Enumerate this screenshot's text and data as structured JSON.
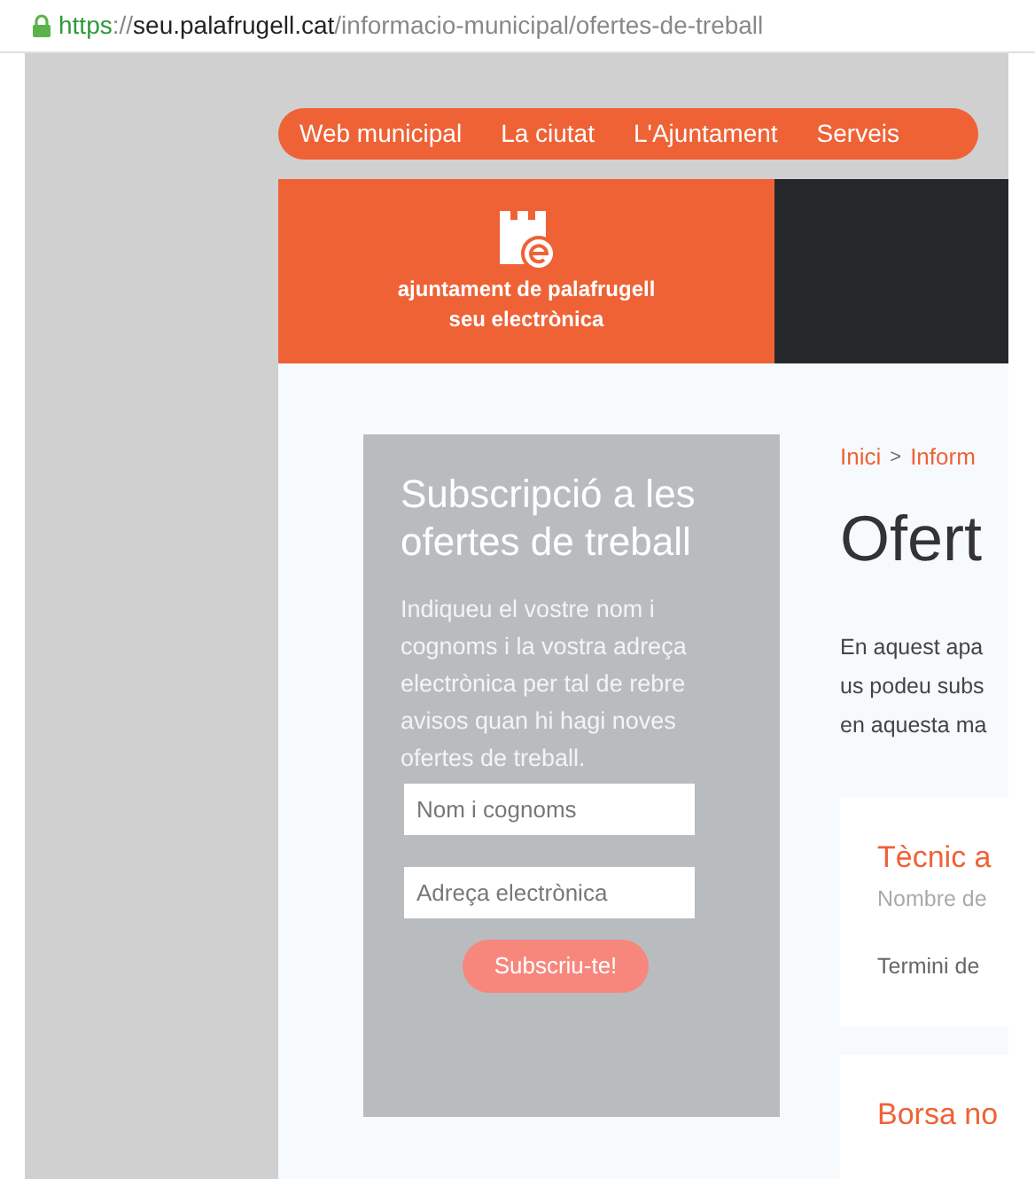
{
  "address_bar": {
    "scheme": "https",
    "separator": "://",
    "host": "seu.palafrugell.cat",
    "path": "/informacio-municipal/ofertes-de-treball"
  },
  "nav": [
    "Web municipal",
    "La ciutat",
    "L'Ajuntament",
    "Serveis"
  ],
  "logo": {
    "line_1": "ajuntament de palafrugell",
    "line_2": "seu electrònica"
  },
  "sidebar": {
    "title": "Subscripció a les ofertes de treball",
    "text": "Indiqueu el vostre nom i cognoms i la vostra adreça electrònica per tal de rebre avisos quan hi hagi noves ofertes de treball.",
    "fields": [
      {
        "placeholder": "Nom i cognoms"
      },
      {
        "placeholder": "Adreça electrònica"
      }
    ],
    "button": "Subscriu-te!"
  },
  "breadcrumb": [
    "Inici",
    "Inform"
  ],
  "breadcrumb_separator": ">",
  "page_title": "Ofert",
  "intro_lines": [
    "En aquest apa",
    "us podeu subs",
    "en aquesta ma"
  ],
  "offers": [
    {
      "title": "Tècnic a",
      "lines": [
        "Nombre de",
        "Termini de"
      ]
    },
    {
      "title": "Borsa no"
    }
  ]
}
